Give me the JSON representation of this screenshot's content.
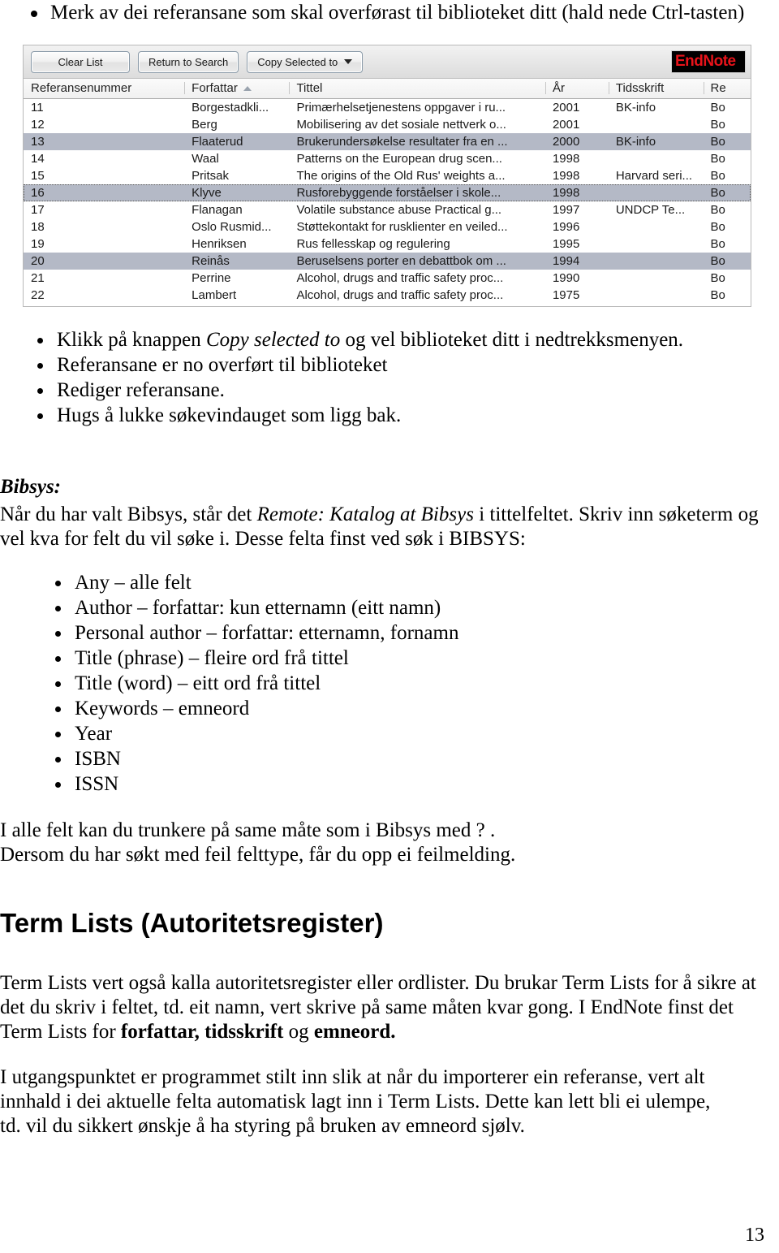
{
  "top_instruction": "Merk av dei referansane som skal overførast til biblioteket ditt (hald nede Ctrl-tasten)",
  "screenshot": {
    "app_name": "EndNote",
    "logo_text": "EndNote",
    "toolbar": {
      "clear_list": "Clear List",
      "return_to_search": "Return to Search",
      "copy_selected_to": "Copy Selected to"
    },
    "columns": [
      "Referansenummer",
      "Forfattar",
      "Tittel",
      "År",
      "Tidsskrift",
      "Re"
    ],
    "sorted_column": "Forfattar",
    "sort_direction": "ascending",
    "rows": [
      {
        "num": "11",
        "author": "Borgestadkli...",
        "title": "Primærhelsetjenestens oppgaver i ru...",
        "year": "2001",
        "journal": "BK-info",
        "type": "Bo",
        "selected": false
      },
      {
        "num": "12",
        "author": "Berg",
        "title": "Mobilisering av det sosiale nettverk o...",
        "year": "2001",
        "journal": "",
        "type": "Bo",
        "selected": false
      },
      {
        "num": "13",
        "author": "Flaaterud",
        "title": "Brukerundersøkelse resultater fra en ...",
        "year": "2000",
        "journal": "BK-info",
        "type": "Bo",
        "selected": true
      },
      {
        "num": "14",
        "author": "Waal",
        "title": "Patterns on the European drug scen...",
        "year": "1998",
        "journal": "",
        "type": "Bo",
        "selected": false
      },
      {
        "num": "15",
        "author": "Pritsak",
        "title": "The origins of the Old Rus' weights a...",
        "year": "1998",
        "journal": "Harvard seri...",
        "type": "Bo",
        "selected": false
      },
      {
        "num": "16",
        "author": "Klyve",
        "title": "Rusforebyggende forståelser i skole...",
        "year": "1998",
        "journal": "",
        "type": "Bo",
        "selected": true,
        "focused": true
      },
      {
        "num": "17",
        "author": "Flanagan",
        "title": "Volatile substance abuse Practical g...",
        "year": "1997",
        "journal": "UNDCP Te...",
        "type": "Bo",
        "selected": false
      },
      {
        "num": "18",
        "author": "Oslo Rusmid...",
        "title": "Støttekontakt for rusklienter en veiled...",
        "year": "1996",
        "journal": "",
        "type": "Bo",
        "selected": false
      },
      {
        "num": "19",
        "author": "Henriksen",
        "title": "Rus fellesskap og regulering",
        "year": "1995",
        "journal": "",
        "type": "Bo",
        "selected": false
      },
      {
        "num": "20",
        "author": "Reinås",
        "title": "Beruselsens porter en debattbok om ...",
        "year": "1994",
        "journal": "",
        "type": "Bo",
        "selected": true
      },
      {
        "num": "21",
        "author": "Perrine",
        "title": "Alcohol, drugs and traffic safety proc...",
        "year": "1990",
        "journal": "",
        "type": "Bo",
        "selected": false
      },
      {
        "num": "22",
        "author": "Lambert",
        "title": "Alcohol, drugs and traffic safety proc...",
        "year": "1975",
        "journal": "",
        "type": "Bo",
        "selected": false
      }
    ]
  },
  "steps": [
    {
      "prefix": "Klikk på knappen ",
      "italic": "Copy selected to",
      "suffix": " og vel biblioteket ditt i nedtrekksmenyen."
    },
    {
      "prefix": "Referansane er no overført til biblioteket",
      "italic": "",
      "suffix": ""
    },
    {
      "prefix": "Rediger referansane.",
      "italic": "",
      "suffix": ""
    },
    {
      "prefix": "Hugs å lukke søkevindauget som ligg bak.",
      "italic": "",
      "suffix": ""
    }
  ],
  "bibsys": {
    "heading": "Bibsys:",
    "intro_before": "Når du har valt Bibsys, står det ",
    "intro_italic": "Remote: Katalog at Bibsys",
    "intro_after": " i tittelfeltet. Skriv inn søketerm og vel  kva for felt du vil søke i. Desse felta finst ved søk i BIBSYS:",
    "fields": [
      "Any – alle felt",
      "Author – forfattar: kun etternamn (eitt namn)",
      "Personal author – forfattar: etternamn, fornamn",
      "Title (phrase) – fleire ord frå tittel",
      "Title (word) – eitt ord frå tittel",
      "Keywords – emneord",
      "Year",
      "ISBN",
      "ISSN"
    ],
    "note_line1": "I alle felt kan du trunkere på same måte som i Bibsys med ? .",
    "note_line2": "Dersom du har søkt med feil felttype, får du opp ei feilmelding."
  },
  "term_lists": {
    "heading": "Term Lists (Autoritetsregister)",
    "para1_a": "Term Lists vert også kalla autoritetsregister eller ordlister. Du brukar Term Lists for å sikre at det du skriv i feltet, td. eit namn, vert skrive på same måten kvar gong. I EndNote finst det Term Lists for ",
    "para1_bold1": "forfattar, tidsskrift",
    "para1_b": " og ",
    "para1_bold2": "emneord.",
    "para2": "I utgangspunktet er programmet stilt inn slik at når du importerer ein referanse, vert alt innhald i dei aktuelle felta automatisk lagt inn i Term Lists. Dette kan lett bli ei ulempe, td. vil du sikkert ønskje å ha styring på bruken av emneord sjølv."
  },
  "page_number": "13"
}
